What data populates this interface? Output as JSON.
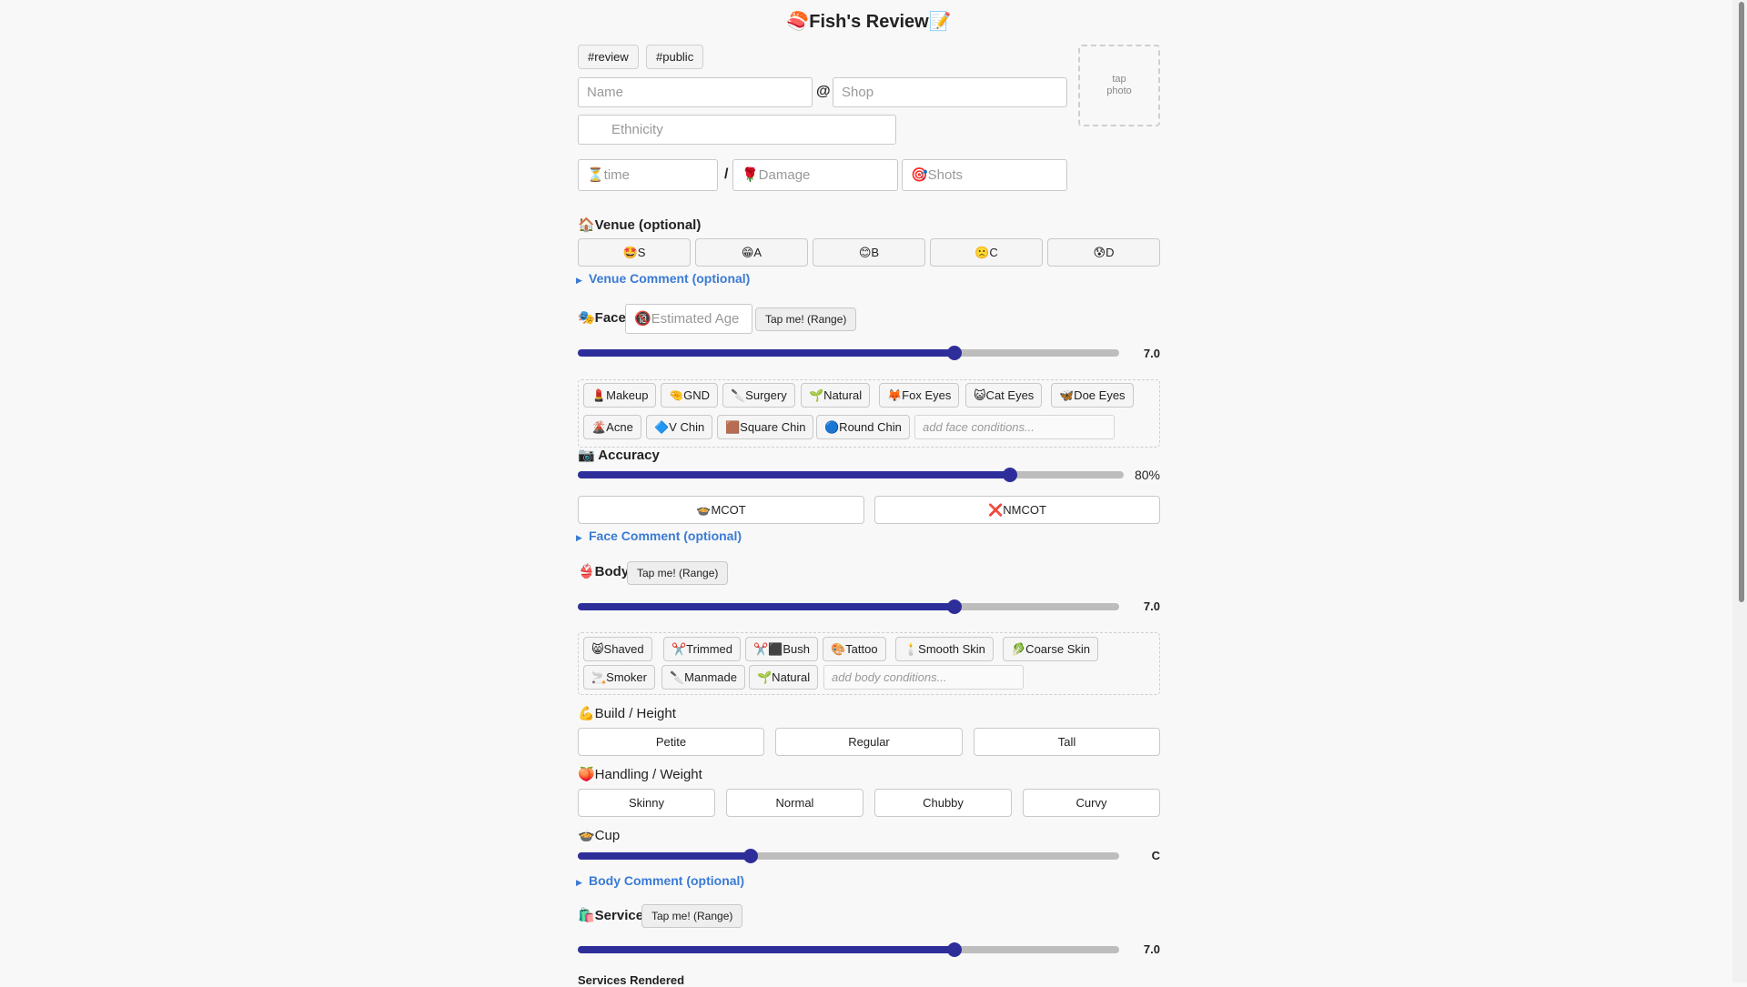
{
  "title": "🍣Fish's Review📝",
  "tags": [
    "#review",
    "#public"
  ],
  "fields": {
    "name_placeholder": "Name",
    "at_sign": "@",
    "shop_placeholder": "Shop",
    "ethnicity_placeholder": "Ethnicity",
    "time_placeholder": "⏳time",
    "slash": "/",
    "damage_placeholder": "🌹Damage",
    "shots_placeholder": "🎯Shots"
  },
  "photo": {
    "line1": "tap",
    "line2": "photo"
  },
  "venue": {
    "label": "🏠Venue (optional)",
    "grades": [
      "🤩S",
      "😁A",
      "😊B",
      "🙁C",
      "😰D"
    ],
    "comment_label": "Venue Comment (optional)"
  },
  "face": {
    "label": "🎭Face",
    "age_placeholder": "🔞Estimated Age",
    "range_button": "Tap me! (Range)",
    "score": 7.0,
    "score_text": "7.0",
    "conditions_row1": [
      "💄Makeup",
      "🤏GND",
      "🔪Surgery",
      "🌱Natural",
      "🦊Fox Eyes",
      "😺Cat Eyes",
      "🦋Doe Eyes"
    ],
    "conditions_row2": [
      "🌋Acne",
      "🔷V Chin",
      "🟫Square Chin",
      "🔵Round Chin"
    ],
    "conditions_placeholder": "add face conditions...",
    "accuracy_label": "📷 Accuracy",
    "accuracy": 80,
    "accuracy_text": "80%",
    "mcot": "🍲MCOT",
    "nmcot": "❌NMCOT",
    "comment_label": "Face Comment (optional)"
  },
  "body": {
    "label": "👙Body",
    "range_button": "Tap me! (Range)",
    "score": 7.0,
    "score_text": "7.0",
    "conditions_row1": [
      "😸Shaved",
      "✂️Trimmed",
      "✂️⬛Bush",
      "🎨Tattoo",
      "🕯️Smooth Skin",
      "🥬Coarse Skin"
    ],
    "conditions_row2": [
      "🚬Smoker",
      "🔪Manmade",
      "🌱Natural"
    ],
    "conditions_placeholder": "add body conditions...",
    "build_label": "💪Build / Height",
    "build_options": [
      "Petite",
      "Regular",
      "Tall"
    ],
    "handling_label": "🍑Handling / Weight",
    "handling_options": [
      "Skinny",
      "Normal",
      "Chubby",
      "Curvy"
    ],
    "cup_label": "🍲Cup",
    "cup_value": "C",
    "cup_fraction": 0.32,
    "comment_label": "Body Comment (optional)"
  },
  "service": {
    "label": "🛍️Service",
    "range_button": "Tap me! (Range)",
    "score": 7.0,
    "score_text": "7.0",
    "rendered_label": "Services Rendered"
  }
}
